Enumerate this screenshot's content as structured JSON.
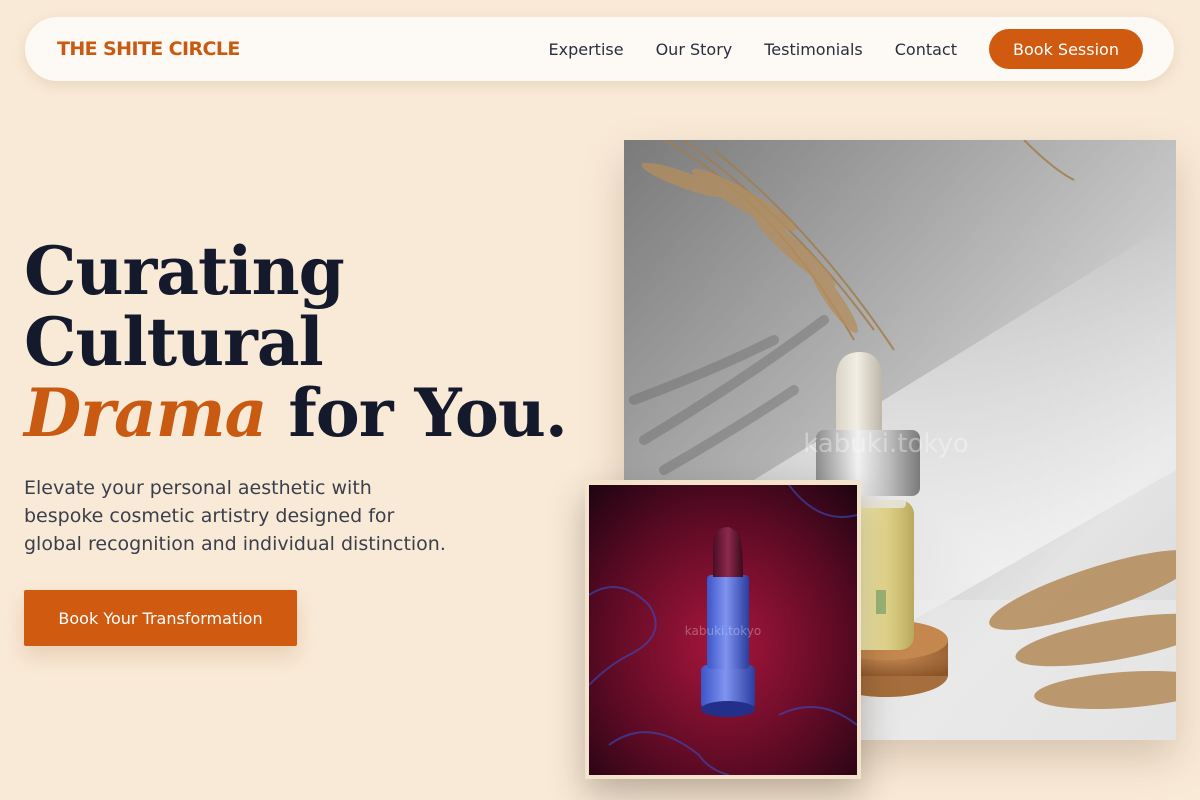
{
  "nav": {
    "brand": "THE SHITE CIRCLE",
    "links": [
      "Expertise",
      "Our Story",
      "Testimonials",
      "Contact"
    ],
    "cta": "Book Session"
  },
  "hero": {
    "line1": "Curating",
    "line2": "Cultural",
    "accent_word": "Drama",
    "line3_rest": "for You.",
    "lede_lines": [
      "Elevate your personal aesthetic with",
      "bespoke cosmetic artistry designed for",
      "global recognition and individual distinction."
    ],
    "cta": "Book Your Transformation"
  },
  "images": {
    "main_watermark": "kabuki.tokyo",
    "inset_watermark": "kabuki.tokyo"
  },
  "colors": {
    "background": "#f9ead7",
    "accent": "#d05a10",
    "heading": "#141a2b"
  }
}
